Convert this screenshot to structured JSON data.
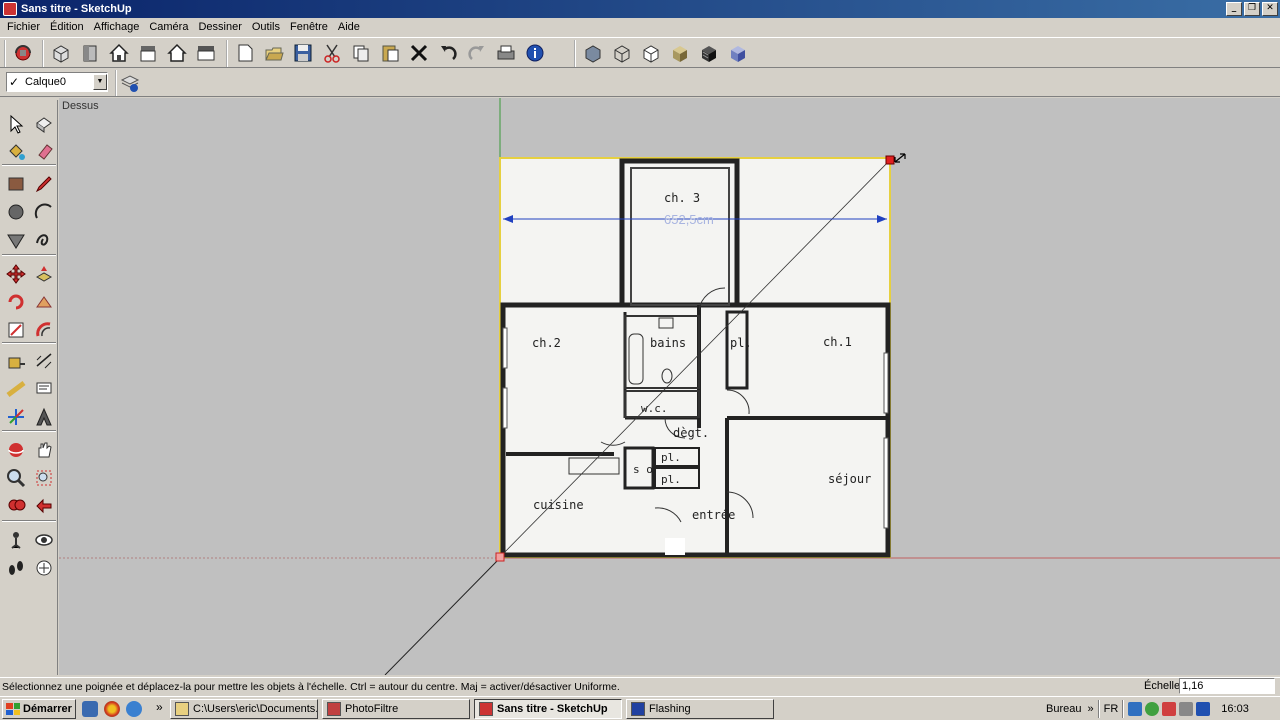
{
  "window": {
    "title": "Sans titre - SketchUp",
    "controls": [
      "_",
      "❐",
      "✕"
    ]
  },
  "menu": [
    "Fichier",
    "Édition",
    "Affichage",
    "Caméra",
    "Dessiner",
    "Outils",
    "Fenêtre",
    "Aide"
  ],
  "toolbar": {
    "groups": [
      {
        "name": "getting-started",
        "icons": [
          "camera-orbit-icon"
        ]
      },
      {
        "name": "views",
        "icons": [
          "iso-view-icon",
          "front-view-icon",
          "house-front-icon",
          "house-side-icon",
          "house-back-icon",
          "plan-view-icon"
        ]
      },
      {
        "name": "standard",
        "icons": [
          "new-file-icon",
          "open-file-icon",
          "save-icon",
          "cut-icon",
          "copy-icon",
          "paste-icon",
          "erase-icon",
          "undo-icon",
          "redo-icon",
          "print-icon",
          "model-info-icon"
        ]
      },
      {
        "name": "styles",
        "icons": [
          "xray-icon",
          "wireframe-icon",
          "hidden-line-icon",
          "shaded-icon",
          "shaded-texture-icon",
          "monochrome-icon"
        ]
      }
    ]
  },
  "layers": {
    "current_layer": "Calque0",
    "checkmark": "✓"
  },
  "palette": {
    "rows": [
      [
        "select-icon",
        "component-icon"
      ],
      [
        "paint-bucket-icon",
        "eraser-icon"
      ],
      [
        "rectangle-icon",
        "pencil-icon"
      ],
      [
        "circle-icon",
        "arc-icon"
      ],
      [
        "polygon-icon",
        "freehand-icon"
      ],
      [
        "move-icon",
        "push-pull-icon"
      ],
      [
        "rotate-icon",
        "follow-me-icon"
      ],
      [
        "scale-icon",
        "offset-icon"
      ],
      [
        "tape-measure-icon",
        "dimension-icon"
      ],
      [
        "protractor-icon",
        "text-icon"
      ],
      [
        "axes-icon",
        "3d-text-icon"
      ],
      [
        "orbit-icon",
        "pan-icon"
      ],
      [
        "zoom-icon",
        "zoom-window-icon"
      ],
      [
        "zoom-extents-icon",
        "previous-view-icon"
      ],
      [
        "position-camera-icon",
        "look-around-icon"
      ],
      [
        "walk-icon",
        "section-plane-icon"
      ]
    ]
  },
  "viewport": {
    "view_name": "Dessus",
    "dimension_label": "652,5cm",
    "rooms": [
      "ch. 3",
      "ch.2",
      "bains",
      "pl.",
      "ch.1",
      "w.c.",
      "dègt.",
      "pl.",
      "pl.",
      "s o",
      "séjour",
      "cuisine",
      "entrée"
    ]
  },
  "status": {
    "hint": "Sélectionnez une poignée et déplacez-la pour mettre les objets à l'échelle. Ctrl = autour du centre. Maj = activer/désactiver Uniforme.",
    "measure_label": "Échelle",
    "measure_value": "1,16"
  },
  "taskbar": {
    "start_label": "Démarrer",
    "tasks": [
      {
        "label": "C:\\Users\\eric\\Documents...",
        "active": false
      },
      {
        "label": "PhotoFiltre",
        "active": false
      },
      {
        "label": "Sans titre - SketchUp",
        "active": true
      },
      {
        "label": "Flashing",
        "active": false
      }
    ],
    "tray": {
      "desktop_label": "Bureau",
      "chevron": "»",
      "language": "FR",
      "clock": "16:03"
    }
  },
  "colors": {
    "titlebar_start": "#0a246a",
    "titlebar_end": "#3a6ea5",
    "viewport_bg": "#c0c0c0",
    "selection_handle": "#e02020",
    "dimension_line": "#2040c0",
    "green_axis": "#3a9a3a",
    "red_axis": "#c06060"
  }
}
